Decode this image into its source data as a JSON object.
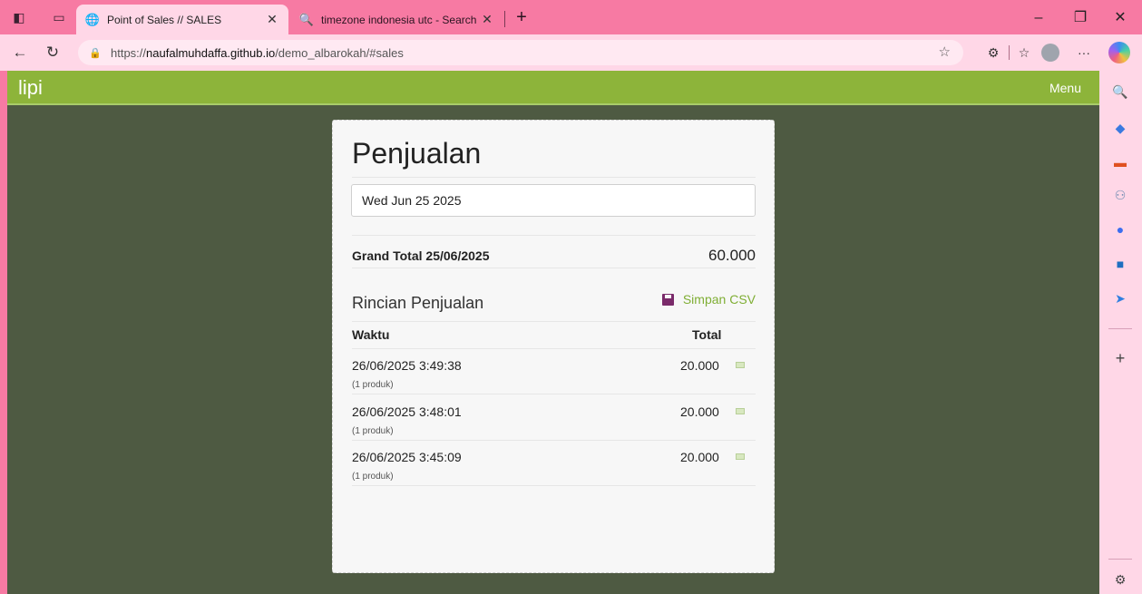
{
  "browser": {
    "tabs": [
      {
        "title": "Point of Sales // SALES",
        "favicon": "globe-icon",
        "active": true
      },
      {
        "title": "timezone indonesia utc - Search",
        "favicon": "search-icon",
        "active": false
      }
    ],
    "url_prefix": "https://",
    "url_host": "naufalmuhdaffa.github.io",
    "url_path": "/demo_albarokah/#sales",
    "accent_color": "#f77aa3",
    "toolbar_color": "#ffd7e7"
  },
  "app": {
    "brand": "lipi",
    "menu_label": "Menu",
    "bar_color": "#8db43a",
    "background_color": "#4e5a42"
  },
  "sales": {
    "title": "Penjualan",
    "date_value": "Wed Jun 25 2025",
    "grand_total_label": "Grand Total 25/06/2025",
    "grand_total_value": "60.000",
    "details_title": "Rincian Penjualan",
    "csv_label": "Simpan CSV",
    "columns": {
      "time": "Waktu",
      "total": "Total"
    },
    "rows": [
      {
        "time": "26/06/2025 3:49:38",
        "count": "(1 produk)",
        "total": "20.000"
      },
      {
        "time": "26/06/2025 3:48:01",
        "count": "(1 produk)",
        "total": "20.000"
      },
      {
        "time": "26/06/2025 3:45:09",
        "count": "(1 produk)",
        "total": "20.000"
      }
    ]
  }
}
